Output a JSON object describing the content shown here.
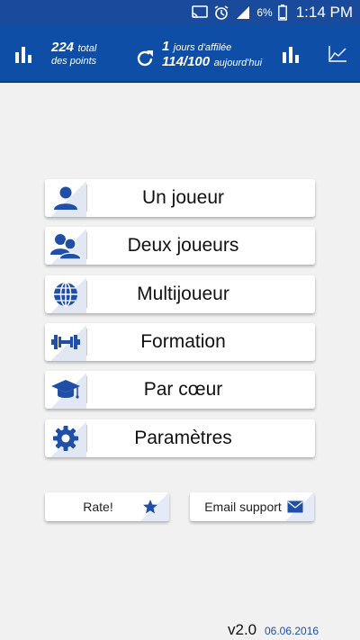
{
  "status_bar": {
    "battery_percent": "6%",
    "time": "1:14 PM"
  },
  "header": {
    "total_points_value": "224",
    "total_label": "total",
    "points_label": "des points",
    "streak_value": "1",
    "streak_label": "jours d'affilée",
    "today_value": "114/100",
    "today_label": "aujourd'hui"
  },
  "menu": {
    "items": [
      {
        "label": "Un joueur",
        "icon": "single-player-icon"
      },
      {
        "label": "Deux joueurs",
        "icon": "two-players-icon"
      },
      {
        "label": "Multijoueur",
        "icon": "globe-icon"
      },
      {
        "label": "Formation",
        "icon": "dumbbell-icon"
      },
      {
        "label": "Par cœur",
        "icon": "graduation-cap-icon"
      },
      {
        "label": "Paramètres",
        "icon": "gear-icon"
      }
    ]
  },
  "actions": {
    "rate_label": "Rate!",
    "email_label": "Email support"
  },
  "footer": {
    "version": "v2.0",
    "date": "06.06.2016"
  },
  "colors": {
    "header_blue": "#0f4ea6",
    "icon_blue": "#1f4fa6",
    "background": "#f1f1f1"
  }
}
